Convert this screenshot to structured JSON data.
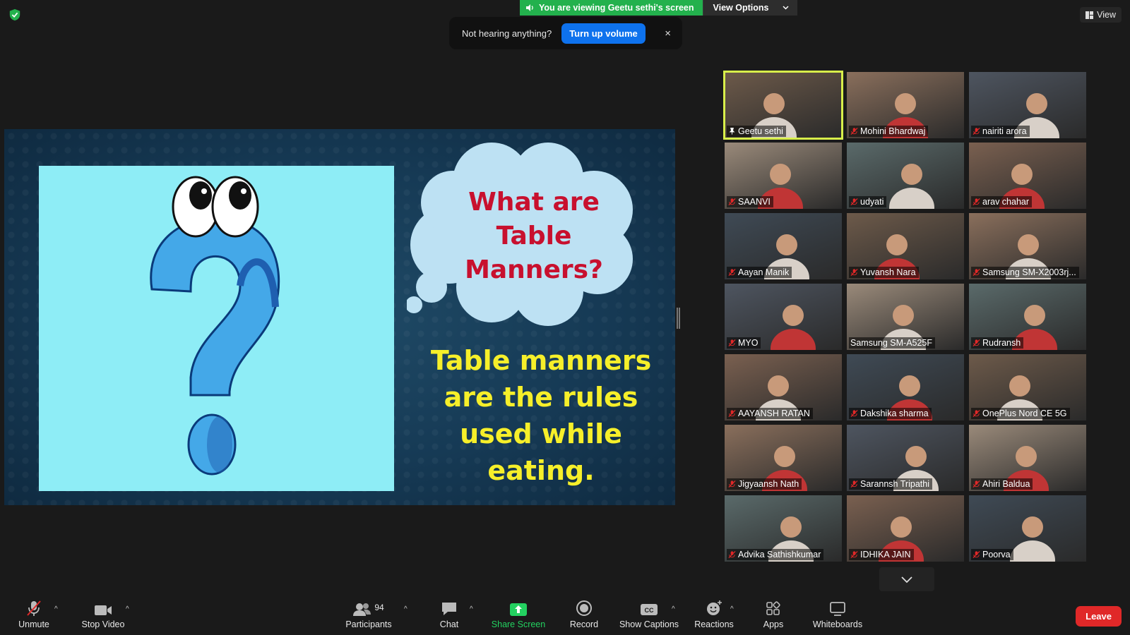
{
  "banner": {
    "viewing_text": "You are viewing Geetu sethi's screen",
    "view_options": "View Options"
  },
  "view_button": "View",
  "toast": {
    "message": "Not hearing anything?",
    "button": "Turn up volume",
    "close": "×"
  },
  "slide": {
    "cloud_lines": [
      "What are",
      "Table",
      "Manners?"
    ],
    "definition_lines": [
      "Table manners",
      "are the rules",
      "used while",
      "eating."
    ]
  },
  "participants": [
    {
      "name": "Geetu sethi",
      "pinned": true,
      "muted": false,
      "active": true
    },
    {
      "name": "Mohini Bhardwaj",
      "muted": true
    },
    {
      "name": "nairiti arora",
      "muted": true
    },
    {
      "name": "SAANVI",
      "muted": true
    },
    {
      "name": "udyati",
      "muted": true
    },
    {
      "name": "arav chahar",
      "muted": true
    },
    {
      "name": "Aayan Manik",
      "muted": true
    },
    {
      "name": "Yuvansh Nara",
      "muted": true
    },
    {
      "name": "Samsung SM-X2003rj...",
      "muted": true
    },
    {
      "name": "MYO",
      "muted": true
    },
    {
      "name": "Samsung SM-A525F",
      "muted": false
    },
    {
      "name": "Rudransh",
      "muted": true
    },
    {
      "name": "AAYANSH RATAN",
      "muted": true
    },
    {
      "name": "Dakshika sharma",
      "muted": true
    },
    {
      "name": "OnePlus Nord CE 5G",
      "muted": true
    },
    {
      "name": "Jigyaansh Nath",
      "muted": true
    },
    {
      "name": "Sarannsh Tripathi",
      "muted": true
    },
    {
      "name": "Ahiri Baldua",
      "muted": true
    },
    {
      "name": "Advika Sathishkumar",
      "muted": true
    },
    {
      "name": "IDHIKA JAIN",
      "muted": true
    },
    {
      "name": "Poorva",
      "muted": true
    }
  ],
  "toolbar": {
    "unmute": "Unmute",
    "stop_video": "Stop Video",
    "participants": "Participants",
    "participants_count": "94",
    "chat": "Chat",
    "share_screen": "Share Screen",
    "record": "Record",
    "show_captions": "Show Captions",
    "reactions": "Reactions",
    "apps": "Apps",
    "whiteboards": "Whiteboards",
    "leave": "Leave"
  },
  "colors": {
    "accent_blue": "#0e72ed",
    "banner_green": "#23b14d",
    "leave_red": "#e02828",
    "active_speaker": "#d8ef4a"
  }
}
